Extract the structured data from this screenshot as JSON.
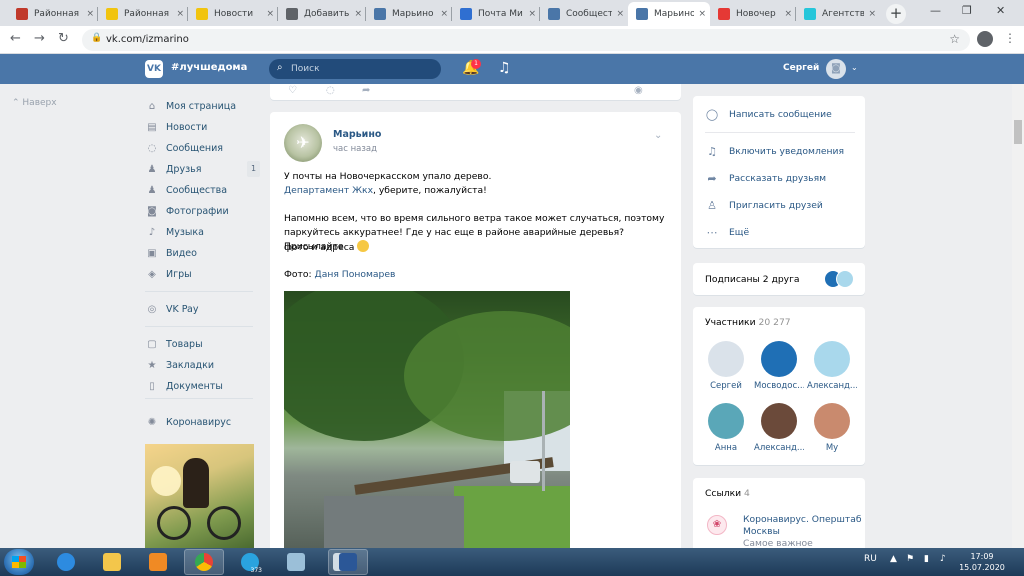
{
  "browser": {
    "tabs": [
      {
        "label": "Районная",
        "color": "#c0392b"
      },
      {
        "label": "Районная",
        "color": "#f1c40f"
      },
      {
        "label": "Новости",
        "color": "#f1c40f"
      },
      {
        "label": "Добавить",
        "color": "#5f6368"
      },
      {
        "label": "Марьино",
        "color": "#4a76a8"
      },
      {
        "label": "Почта Ми",
        "color": "#2f6fd1"
      },
      {
        "label": "Сообщест",
        "color": "#4a76a8"
      },
      {
        "label": "Марьино",
        "color": "#4a76a8"
      },
      {
        "label": "Новочер",
        "color": "#e53935"
      },
      {
        "label": "Агентств",
        "color": "#26c6da"
      }
    ],
    "active_tab_index": 7,
    "url": "vk.com/izmarino"
  },
  "vk_header": {
    "logo": "VK",
    "slogan": "#лучшедома",
    "search_placeholder": "Поиск",
    "notifications_count": "1",
    "user_name": "Сергей"
  },
  "scroll_up": "Наверх",
  "left_menu": [
    {
      "label": "Моя страница",
      "icon": "home-icon",
      "glyph": "⌂"
    },
    {
      "label": "Новости",
      "icon": "news-icon",
      "glyph": "▤"
    },
    {
      "label": "Сообщения",
      "icon": "messages-icon",
      "glyph": "◌"
    },
    {
      "label": "Друзья",
      "icon": "friends-icon",
      "glyph": "♟",
      "badge": "1"
    },
    {
      "label": "Сообщества",
      "icon": "communities-icon",
      "glyph": "♟"
    },
    {
      "label": "Фотографии",
      "icon": "photos-icon",
      "glyph": "◙"
    },
    {
      "label": "Музыка",
      "icon": "music-icon",
      "glyph": "♪"
    },
    {
      "label": "Видео",
      "icon": "video-icon",
      "glyph": "▣"
    },
    {
      "label": "Игры",
      "icon": "games-icon",
      "glyph": "◈"
    },
    {
      "label": "VK Pay",
      "icon": "vkpay-icon",
      "glyph": "◎"
    },
    {
      "label": "Товары",
      "icon": "goods-icon",
      "glyph": "▢"
    },
    {
      "label": "Закладки",
      "icon": "bookmarks-icon",
      "glyph": "★"
    },
    {
      "label": "Документы",
      "icon": "documents-icon",
      "glyph": "▯"
    },
    {
      "label": "Коронавирус",
      "icon": "coronavirus-icon",
      "glyph": "✺"
    }
  ],
  "post": {
    "author": "Марьино",
    "time": "час назад",
    "line1": "У почты на Новочеркасском упало дерево.",
    "line2_link": "Департамент Жкх",
    "line2_rest": ", уберите, пожалуйста!",
    "para2_line1": "Напомню всем, что во время сильного ветра такое может случаться, поэтому",
    "para2_line2": "паркуйтесь аккуратнее! Где у нас еще в районе аварийные деревья? Присылайте",
    "para2_line3": "фото и адреса",
    "photo_prefix": "Фото: ",
    "photo_author": "Даня Пономарев"
  },
  "actions": [
    {
      "label": "Написать сообщение",
      "icon": "message-icon",
      "glyph": "◯"
    },
    {
      "label": "Включить уведомления",
      "icon": "bell-icon",
      "glyph": "♫"
    },
    {
      "label": "Рассказать друзьям",
      "icon": "share-icon",
      "glyph": "➦"
    },
    {
      "label": "Пригласить друзей",
      "icon": "invite-icon",
      "glyph": "♙"
    },
    {
      "label": "Ещё",
      "icon": "more-icon",
      "glyph": "⋯"
    }
  ],
  "subscribed": {
    "label": "Подписаны 2 друга"
  },
  "members": {
    "title": "Участники",
    "count": "20 277",
    "list": [
      {
        "name": "Сергей",
        "color": "#dae2ea"
      },
      {
        "name": "Мосводос...",
        "color": "#1f6fb5"
      },
      {
        "name": "Александ...",
        "color": "#a9d8ec"
      },
      {
        "name": "Анна",
        "color": "#5aa7b8"
      },
      {
        "name": "Александ...",
        "color": "#6b4a3a"
      },
      {
        "name": "Му",
        "color": "#c98a6e"
      }
    ]
  },
  "links": {
    "title": "Ссылки",
    "count": "4",
    "item_line1": "Коронавирус. Оперштаб",
    "item_line2": "Москвы",
    "item_line3": "Самое важное"
  },
  "taskbar": {
    "lang": "RU",
    "time": "17:09",
    "date": "15.07.2020",
    "telegram_count": "373"
  }
}
